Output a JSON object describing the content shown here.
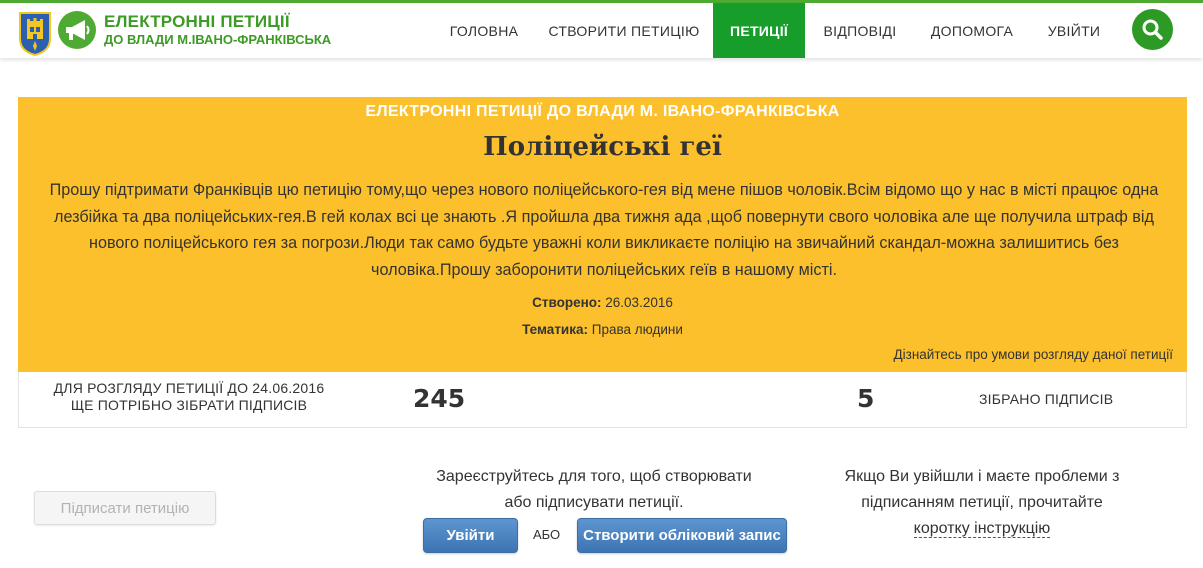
{
  "brand": {
    "line1": "ЕЛЕКТРОННІ ПЕТИЦІЇ",
    "line2": "ДО ВЛАДИ М.ІВАНО-ФРАНКІВСЬКА"
  },
  "nav": {
    "items": [
      {
        "label": "ГОЛОВНА"
      },
      {
        "label": "СТВОРИТИ ПЕТИЦІЮ"
      },
      {
        "label": "ПЕТИЦІЇ",
        "active": true
      },
      {
        "label": "ВІДПОВІДІ"
      },
      {
        "label": "ДОПОМОГА"
      },
      {
        "label": "УВІЙТИ"
      }
    ]
  },
  "petition": {
    "header": "ЕЛЕКТРОННІ ПЕТИЦІЇ ДО ВЛАДИ М. ІВАНО-ФРАНКІВСЬКА",
    "title": "Поліцейські геї",
    "body": "Прошу підтримати Франківців цю петицію тому,що через нового поліцейського-гея від мене пішов чоловік.Всім відомо що у нас в місті працює одна лезбійка та два поліцейських-гея.В гей колах всі це знають .Я пройшла два тижня ада ,щоб повернути свого чоловіка але ще получила штраф від нового поліцейського гея за погрози.Люди так само будьте уважні коли викликаєте поліцію на звичайний скандал-можна залишитись без чоловіка.Прошу заборонити поліцейських геїв в нашому місті.",
    "created_label": "Створено:",
    "created_value": "26.03.2016",
    "topic_label": "Тематика:",
    "topic_value": "Права людини",
    "conditions_link": "Дізнайтесь про умови розгляду даної петиції"
  },
  "counts": {
    "need_line1": "ДЛЯ РОЗГЛЯДУ ПЕТИЦІЇ ДО 24.06.2016",
    "need_line2": "ЩЕ ПОТРІБНО ЗІБРАТИ ПІДПИСІВ",
    "need_value": "245",
    "got_value": "5",
    "got_label": "ЗІБРАНО ПІДПИСІВ"
  },
  "actions": {
    "sign_label": "Підписати петицію",
    "register_line1": "Зареєструйтесь для того, щоб створювати",
    "register_line2": "або підписувати петиції.",
    "login_label": "Увійти",
    "or_label": "АБО",
    "create_label": "Створити обліковий запис",
    "help_line1": "Якщо Ви увійшли і маєте проблеми з",
    "help_line2": "підписанням петиції, прочитайте",
    "help_link": "коротку інструкцію"
  },
  "colors": {
    "brand_green": "#3c9b24",
    "active_nav": "#179d2a",
    "panel_yellow": "#fcc02c",
    "button_blue": "#4a84c2"
  },
  "icons": {
    "crest": "city-crest-icon",
    "logo": "megaphone-icon",
    "search": "search-icon"
  }
}
